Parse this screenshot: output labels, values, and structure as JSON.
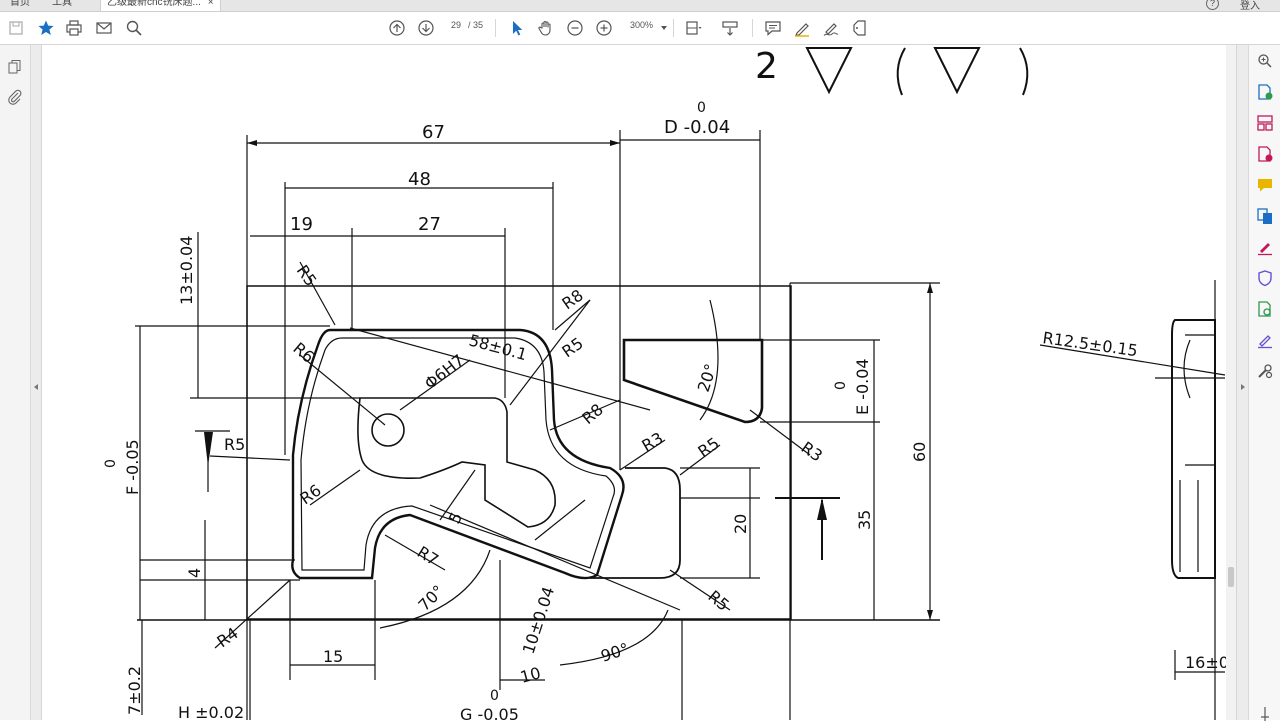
{
  "tabs": [
    {
      "label": "首页"
    },
    {
      "label": "工具"
    },
    {
      "label": "乙级最新cnc铣床题..."
    }
  ],
  "tab_close": "×",
  "top_right": {
    "user_label": "登入"
  },
  "navigation": {
    "page_current": "29",
    "page_total": "/ 35"
  },
  "zoom": {
    "value": "300%"
  },
  "colors": {
    "accent_blue": "#1a6fc4",
    "magenta": "#c2185b",
    "green": "#2e9a4c",
    "yellow": "#e8b500",
    "purple": "#6a4fd1"
  },
  "drawing": {
    "top_sign": "2",
    "dim_67": "67",
    "dim_D": "D -0.04",
    "dim_D_zero": "0",
    "dim_48": "48",
    "dim_19": "19",
    "dim_27": "27",
    "dim_13": "13±0.04",
    "r5_top": "R5",
    "r8_top": "R8",
    "r5_mid": "R5",
    "r6_upper": "R6",
    "dim_58": "58±0.1",
    "dia_6H7": "Φ6H7",
    "r8_mid": "R8",
    "r3_mid": "R3",
    "r5_right": "R5",
    "r3_right": "R3",
    "angle_20": "20°",
    "dim_E": "E -0.04",
    "dim_E_zero": "0",
    "dim_60": "60",
    "dim_35": "35",
    "dim_20": "20",
    "dim_F": "F -0.05",
    "dim_F_zero": "0",
    "r5_left": "R5",
    "r6_lower": "R6",
    "dim_5": "5",
    "r7": "R7",
    "dim_4": "4",
    "angle_70": "70°",
    "r4": "R4",
    "dim_15": "15",
    "dim_10_tol": "10±0.04",
    "dim_10": "10",
    "angle_90": "90°",
    "r5_bottom": "R5",
    "dim_7": "7±0.2",
    "dim_H": "H ±0.02",
    "dim_G": "G -0.05",
    "dim_G_zero": "0",
    "r12": "R12.5±0.15",
    "dim_16": "16±0"
  }
}
